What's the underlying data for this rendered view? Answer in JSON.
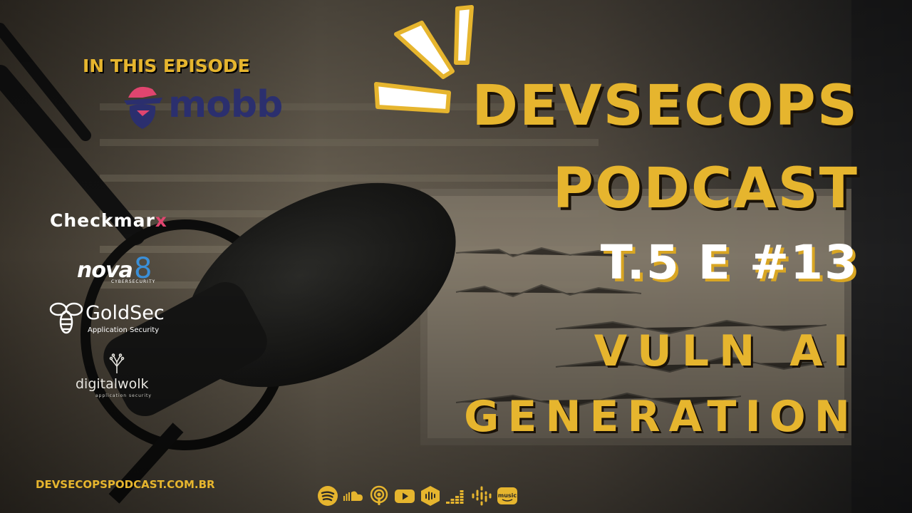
{
  "header": {
    "episode_label": "IN THIS EPISODE"
  },
  "guest": {
    "name": "mobb"
  },
  "sponsors": {
    "checkmarx": {
      "main": "Checkmar",
      "accent": "x"
    },
    "nova8": {
      "name": "nova",
      "digit": "8",
      "sub": "CYBERSECURITY"
    },
    "goldsec": {
      "name": "GoldSec",
      "sub": "Application Security"
    },
    "digitalwolk": {
      "name": "digitalwolk",
      "sub": "application security"
    }
  },
  "title": {
    "line1": "DEVSECOPS",
    "line2": "PODCAST",
    "episode": "T.5 E #13",
    "topic_line1": "VULN AI",
    "topic_line2": "GENERATION"
  },
  "footer": {
    "website": "DEVSECOPSPODCAST.COM.BR"
  },
  "platforms": [
    {
      "icon": "spotify-icon"
    },
    {
      "icon": "soundcloud-icon"
    },
    {
      "icon": "apple-podcasts-icon"
    },
    {
      "icon": "youtube-icon"
    },
    {
      "icon": "castbox-icon"
    },
    {
      "icon": "deezer-icon"
    },
    {
      "icon": "google-podcasts-icon"
    },
    {
      "icon": "amazon-music-icon",
      "label": "music"
    }
  ],
  "colors": {
    "accent": "#e6b52e",
    "brand_mobb": "#2b2f6e",
    "checkmarx_x": "#e0456f"
  }
}
